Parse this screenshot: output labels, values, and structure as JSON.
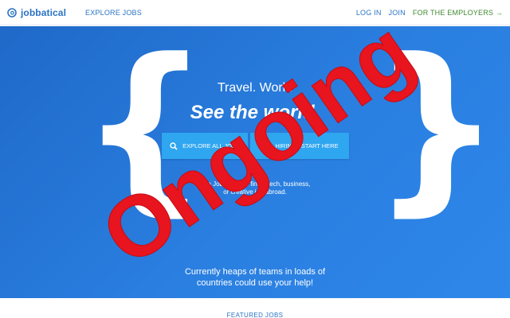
{
  "nav": {
    "brand": "jobbatical",
    "brand_icon": "jobbatical-logo-icon",
    "explore_jobs": "EXPLORE JOBS",
    "login": "LOG IN",
    "join": "JOIN",
    "for_employers": "FOR THE EMPLOYERS →"
  },
  "hero": {
    "line1": "Travel. Work.",
    "line2": "See the world.",
    "explore_button": "EXPLORE ALL JOBS",
    "hiring_button": "HIRING? START HERE",
    "description_line1": "Use Jobbatical to find a tech, business,",
    "description_line2": "or creative job abroad.",
    "bottom_line1": "Currently heaps of teams in loads of",
    "bottom_line2": "countries could use your help!"
  },
  "featured": {
    "title": "FEATURED JOBS"
  },
  "stamp": {
    "text": "Ongoing",
    "color": "#e8141e"
  },
  "colors": {
    "brand_blue": "#2a73c5",
    "employers_green": "#3f8a2f",
    "hero_blue": "#2a7fe0",
    "button_blue": "#2fa6f0"
  }
}
